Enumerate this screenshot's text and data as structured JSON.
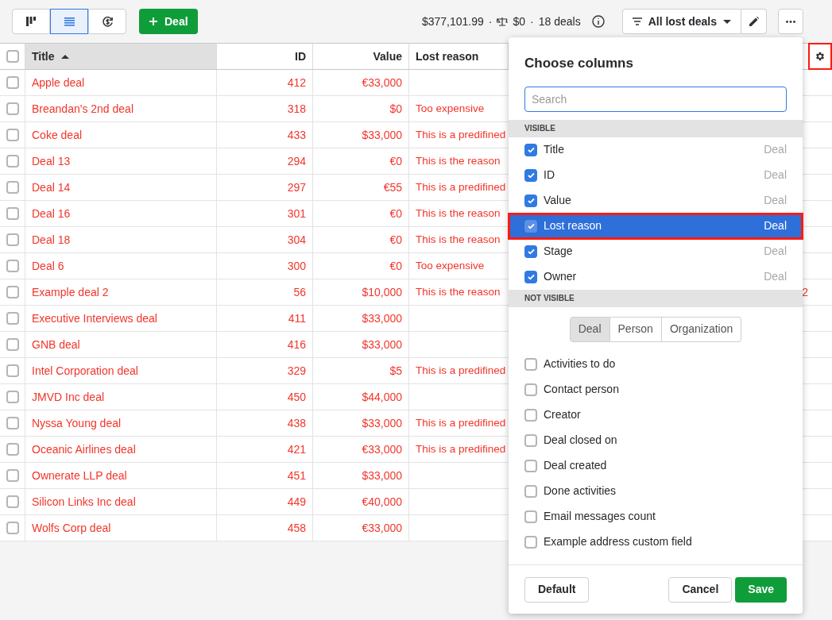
{
  "toolbar": {
    "view_buttons": [
      {
        "kind": "pipeline",
        "selected": false
      },
      {
        "kind": "list",
        "selected": true
      },
      {
        "kind": "forecast",
        "selected": false
      }
    ],
    "add_button": "Deal",
    "summary": {
      "total": "$377,101.99",
      "separator": "·",
      "weighted": "$0",
      "count": "18 deals"
    },
    "filter": "All lost deals"
  },
  "table": {
    "select_all_checked": false,
    "columns": [
      {
        "label": "Title",
        "sorted": true
      },
      {
        "label": "ID",
        "sorted": false
      },
      {
        "label": "Value",
        "sorted": false
      },
      {
        "label": "Lost reason",
        "sorted": false
      }
    ],
    "rows": [
      {
        "checked": false,
        "title": "Apple deal",
        "id": "412",
        "value": "€33,000"
      },
      {
        "checked": false,
        "title": "Breandan's 2nd deal",
        "id": "318",
        "value": "$0",
        "lost_reason": "Too expensive"
      },
      {
        "checked": false,
        "title": "Coke deal",
        "id": "433",
        "value": "$33,000",
        "lost_reason": "This is a predifined"
      },
      {
        "checked": false,
        "title": "Deal 13",
        "id": "294",
        "value": "€0",
        "lost_reason": "This is the reason"
      },
      {
        "checked": false,
        "title": "Deal 14",
        "id": "297",
        "value": "€55",
        "lost_reason": "This is a predifined"
      },
      {
        "checked": false,
        "title": "Deal 16",
        "id": "301",
        "value": "€0",
        "lost_reason": "This is the reason"
      },
      {
        "checked": false,
        "title": "Deal 18",
        "id": "304",
        "value": "€0",
        "lost_reason": "This is the reason"
      },
      {
        "checked": false,
        "title": "Deal 6",
        "id": "300",
        "value": "€0",
        "lost_reason": "Too expensive"
      },
      {
        "checked": false,
        "title": "Example deal 2",
        "id": "56",
        "value": "$10,000",
        "lost_reason": "This is the reason",
        "column_5": "2"
      },
      {
        "checked": false,
        "title": "Executive Interviews deal",
        "id": "411",
        "value": "$33,000"
      },
      {
        "checked": false,
        "title": "GNB deal",
        "id": "416",
        "value": "$33,000"
      },
      {
        "checked": false,
        "title": "Intel Corporation deal",
        "id": "329",
        "value": "$5",
        "lost_reason": "This is a predifined"
      },
      {
        "checked": false,
        "title": "JMVD Inc deal",
        "id": "450",
        "value": "$44,000"
      },
      {
        "checked": false,
        "title": "Nyssa Young deal",
        "id": "438",
        "value": "$33,000",
        "lost_reason": "This is a predifined"
      },
      {
        "checked": false,
        "title": "Oceanic Airlines deal",
        "id": "421",
        "value": "€33,000",
        "lost_reason": "This is a predifined"
      },
      {
        "checked": false,
        "title": "Ownerate LLP deal",
        "id": "451",
        "value": "$33,000"
      },
      {
        "checked": false,
        "title": "Silicon Links Inc deal",
        "id": "449",
        "value": "€40,000"
      },
      {
        "checked": false,
        "title": "Wolfs Corp deal",
        "id": "458",
        "value": "€33,000"
      }
    ]
  },
  "column_chooser": {
    "title": "Choose columns",
    "search": {
      "placeholder": "Search"
    },
    "visible_heading": "VISIBLE",
    "visible": [
      {
        "label": "Title",
        "source": "Deal",
        "checked": true,
        "highlighted": false
      },
      {
        "label": "ID",
        "source": "Deal",
        "checked": true,
        "highlighted": false
      },
      {
        "label": "Value",
        "source": "Deal",
        "checked": true,
        "highlighted": false
      },
      {
        "label": "Lost reason",
        "source": "Deal",
        "checked": true,
        "highlighted": true
      },
      {
        "label": "Stage",
        "source": "Deal",
        "checked": true,
        "highlighted": false
      },
      {
        "label": "Owner",
        "source": "Deal",
        "checked": true,
        "highlighted": false
      }
    ],
    "not_visible_heading": "NOT VISIBLE",
    "tabs": [
      {
        "label": "Deal",
        "selected": true
      },
      {
        "label": "Person",
        "selected": false
      },
      {
        "label": "Organization",
        "selected": false
      }
    ],
    "hidden": [
      {
        "label": "Activities to do",
        "checked": false
      },
      {
        "label": "Contact person",
        "checked": false
      },
      {
        "label": "Creator",
        "checked": false
      },
      {
        "label": "Deal closed on",
        "checked": false
      },
      {
        "label": "Deal created",
        "checked": false
      },
      {
        "label": "Done activities",
        "checked": false
      },
      {
        "label": "Email messages count",
        "checked": false
      },
      {
        "label": "Example address custom field",
        "checked": false
      }
    ],
    "buttons": {
      "default": "Default",
      "cancel": "Cancel",
      "save": "Save"
    }
  }
}
